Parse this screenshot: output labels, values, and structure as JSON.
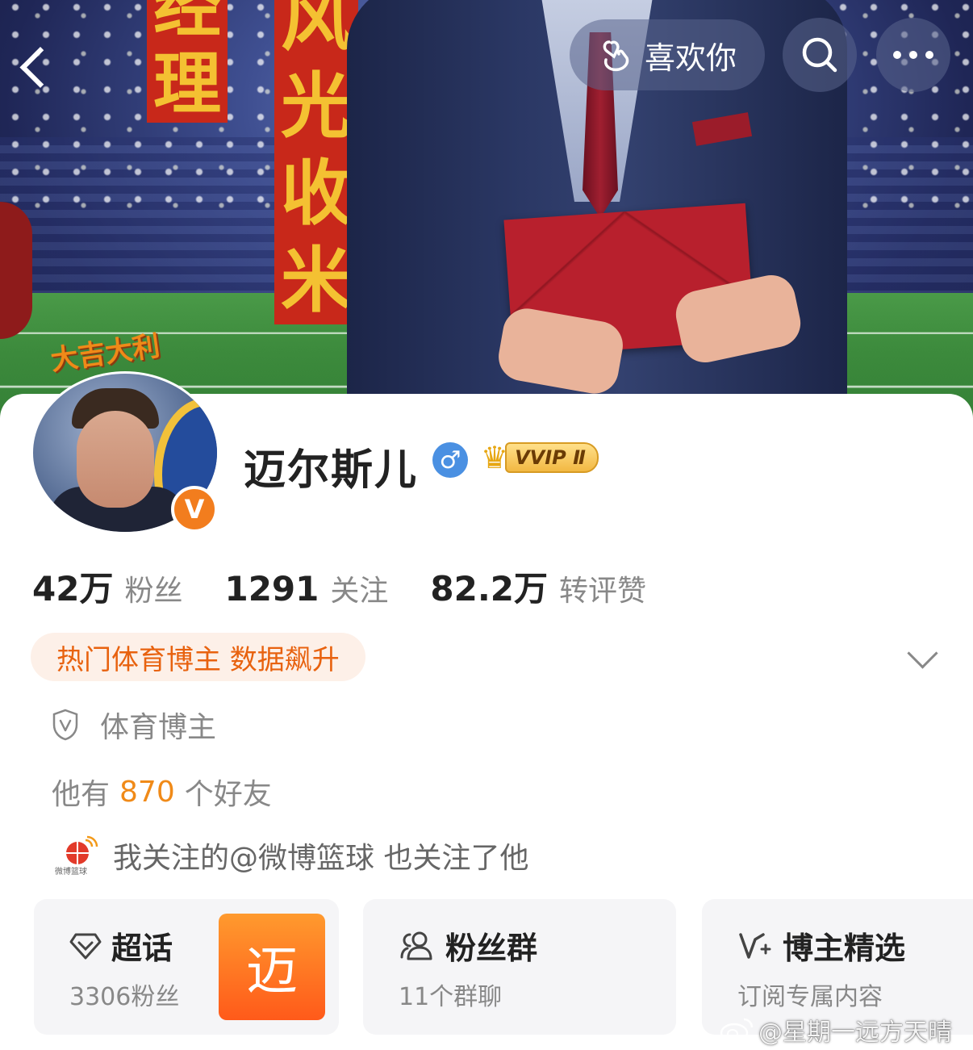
{
  "banner": {
    "text_left": "经理",
    "text_right": "风光收米"
  },
  "nav": {
    "like_label": "喜欢你"
  },
  "profile": {
    "sticker_text": "大吉大利",
    "verified_badge": "V",
    "name": "迈尔斯儿",
    "gender_symbol": "♂",
    "vip_label": "VVIP Ⅱ",
    "stats": [
      {
        "number": "42万",
        "label": "粉丝"
      },
      {
        "number": "1291",
        "label": "关注"
      },
      {
        "number": "82.2万",
        "label": "转评赞"
      }
    ],
    "hot_tag": "热门体育博主 数据飙升",
    "category": "体育博主",
    "friends_prefix": "他有",
    "friends_count": "870",
    "friends_suffix": "个好友",
    "mutual_icon_text": "微博篮球",
    "mutual_follow": "我关注的@微博篮球 也关注了他"
  },
  "tiles": [
    {
      "title": "超话",
      "subtitle": "3306粉丝",
      "badge": "迈"
    },
    {
      "title": "粉丝群",
      "subtitle": "11个群聊"
    },
    {
      "title": "博主精选",
      "subtitle": "订阅专属内容"
    }
  ],
  "watermark": "@星期一远方天晴",
  "colors": {
    "accent_orange": "#f08a18",
    "hot_tag_bg": "#fdf0e8",
    "gender_blue": "#4a90e2"
  }
}
